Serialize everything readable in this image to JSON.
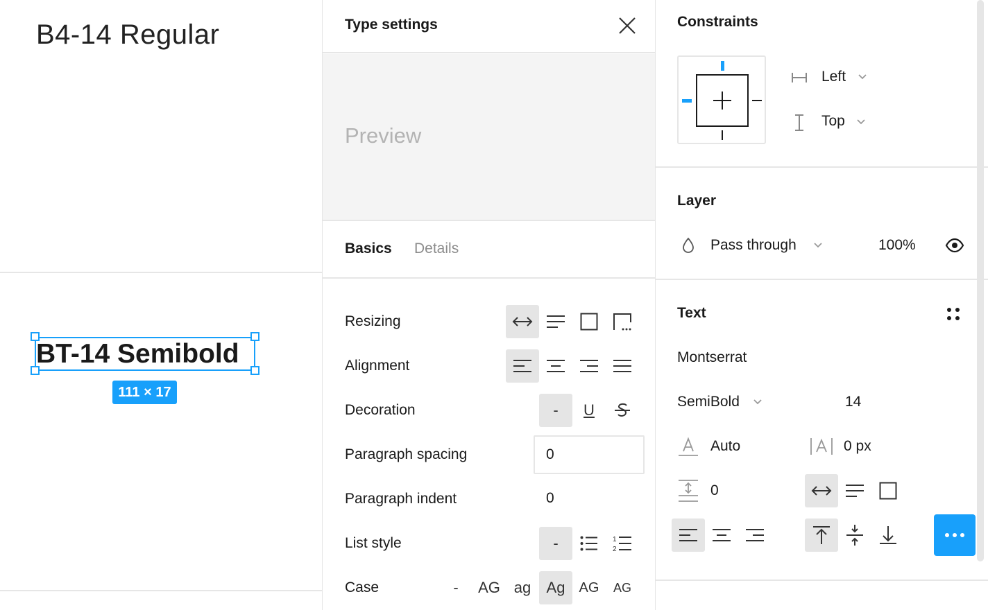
{
  "canvas": {
    "title": "B4-14 Regular",
    "selected_text": "BT-14 Semibold",
    "dimension_badge": "111 × 17"
  },
  "modal": {
    "title": "Type settings",
    "preview_text": "Preview",
    "tabs": [
      {
        "label": "Basics",
        "active": true
      },
      {
        "label": "Details",
        "active": false
      }
    ],
    "rows": {
      "resizing": "Resizing",
      "alignment": "Alignment",
      "decoration": "Decoration",
      "paragraph_spacing": "Paragraph spacing",
      "paragraph_indent": "Paragraph indent",
      "list_style": "List style",
      "case": "Case"
    },
    "decoration_none": "-",
    "decoration_underline": "U",
    "list_none": "-",
    "paragraph_spacing_value": "0",
    "paragraph_indent_value": "0",
    "case_options": [
      "-",
      "AG",
      "ag",
      "Ag",
      "AG",
      "AG"
    ]
  },
  "panel": {
    "constraints": {
      "title": "Constraints",
      "horizontal": "Left",
      "vertical": "Top"
    },
    "layer": {
      "title": "Layer",
      "blend_mode": "Pass through",
      "opacity": "100%"
    },
    "text": {
      "title": "Text",
      "font_family": "Montserrat",
      "font_weight": "SemiBold",
      "font_size": "14",
      "line_height": "Auto",
      "letter_spacing": "0 px",
      "paragraph_spacing": "0"
    }
  },
  "colors": {
    "accent": "#18a0fb",
    "active_button_bg": "#e5e5e5",
    "divider": "#e6e6e6",
    "preview_bg": "#f4f4f4"
  }
}
